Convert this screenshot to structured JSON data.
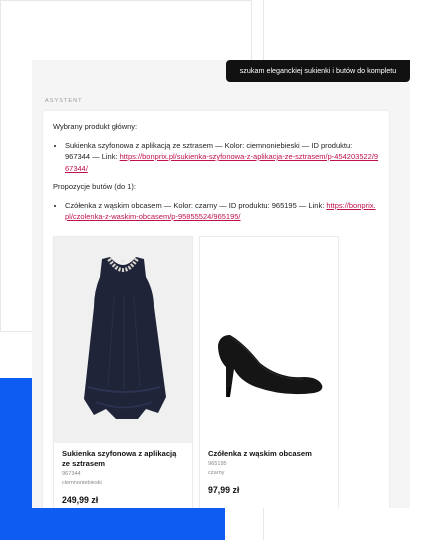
{
  "chat": {
    "user_message": "szukam eleganckiej sukienki i butów do kompletu",
    "assistant_label": "ASYSTENT",
    "assistant": {
      "main_heading": "Wybrany produkt główny:",
      "main_item_text": "Sukienka szyfonowa z aplikacją ze sztrasem — Kolor: ciemnoniebieski — ID produktu: 967344 — Link: ",
      "main_item_link": "https://bonprix.pl/sukienka-szyfonowa-z-aplikacja-ze-sztrasem/p-454203522/967344/",
      "shoes_heading": "Propozycje butów (do 1):",
      "shoes_item_text": "Czółenka z wąskim obcasem — Kolor: czarny — ID produktu: 965195 — Link: ",
      "shoes_item_link": "https://bonprix.pl/czolenka-z-waskim-obcasem/p-95855524/965195/"
    }
  },
  "products": [
    {
      "title": "Sukienka szyfonowa z aplikacją ze sztrasem",
      "id": "967344",
      "color": "ciemnoniebieski",
      "price": "249,99 zł",
      "image_icon": "navy-chiffon-dress-photo"
    },
    {
      "title": "Czółenka z wąskim obcasem",
      "id": "965195",
      "color": "czarny",
      "price": "97,99 zł",
      "image_icon": "black-heel-pump-photo"
    }
  ],
  "colors": {
    "accent_link": "#c0114b",
    "user_bubble": "#111111",
    "cta": "#a61e36",
    "blue_block": "#0f5cf2",
    "dress": "#1f2438"
  }
}
